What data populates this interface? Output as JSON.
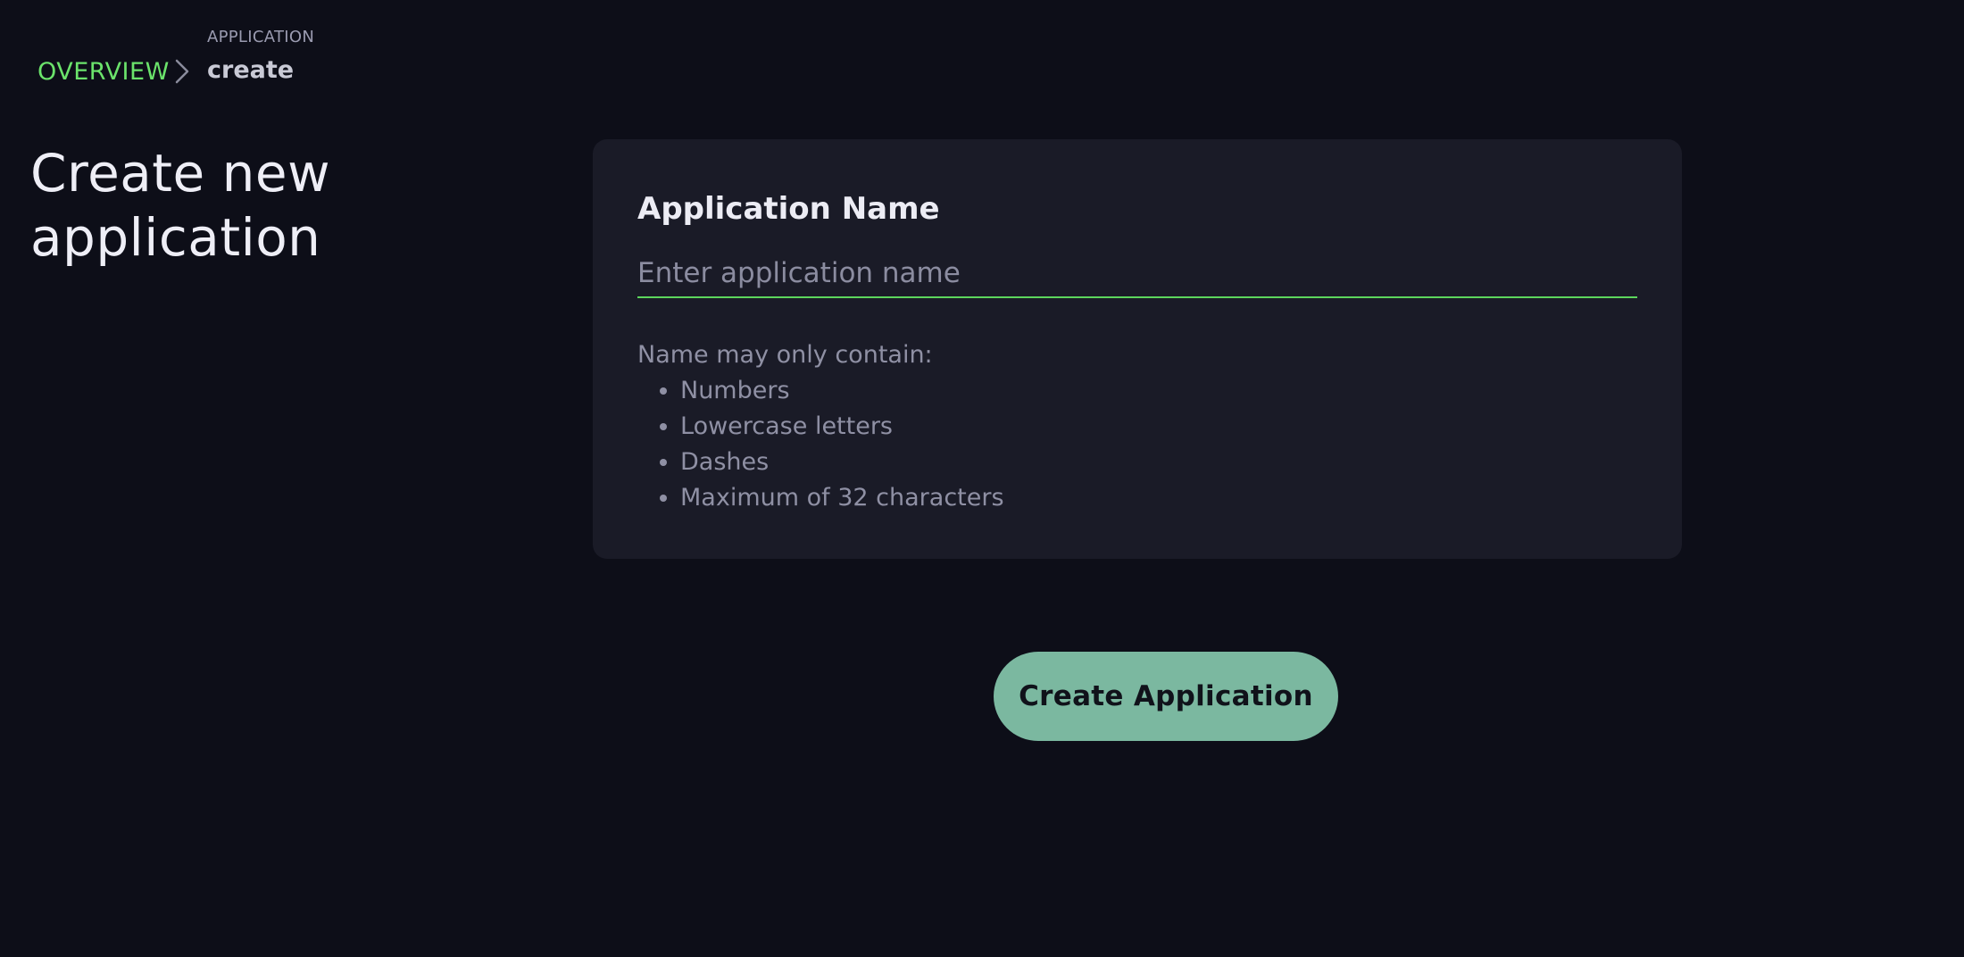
{
  "breadcrumb": {
    "overview_label": "OVERVIEW",
    "section_caption": "APPLICATION",
    "current_label": "create"
  },
  "page_title": "Create new application",
  "form": {
    "name_label": "Application Name",
    "name_placeholder": "Enter application name",
    "name_value": "",
    "rules_intro": "Name may only contain:",
    "rules": [
      "Numbers",
      "Lowercase letters",
      "Dashes",
      "Maximum of 32 characters"
    ]
  },
  "actions": {
    "create_label": "Create Application"
  },
  "colors": {
    "background": "#0d0e18",
    "card": "#1a1b27",
    "accent_green": "#6be36b",
    "input_underline": "#5cd65c",
    "button": "#7bb8a0"
  },
  "icons": {
    "breadcrumb_separator": "chevron-right-icon"
  }
}
